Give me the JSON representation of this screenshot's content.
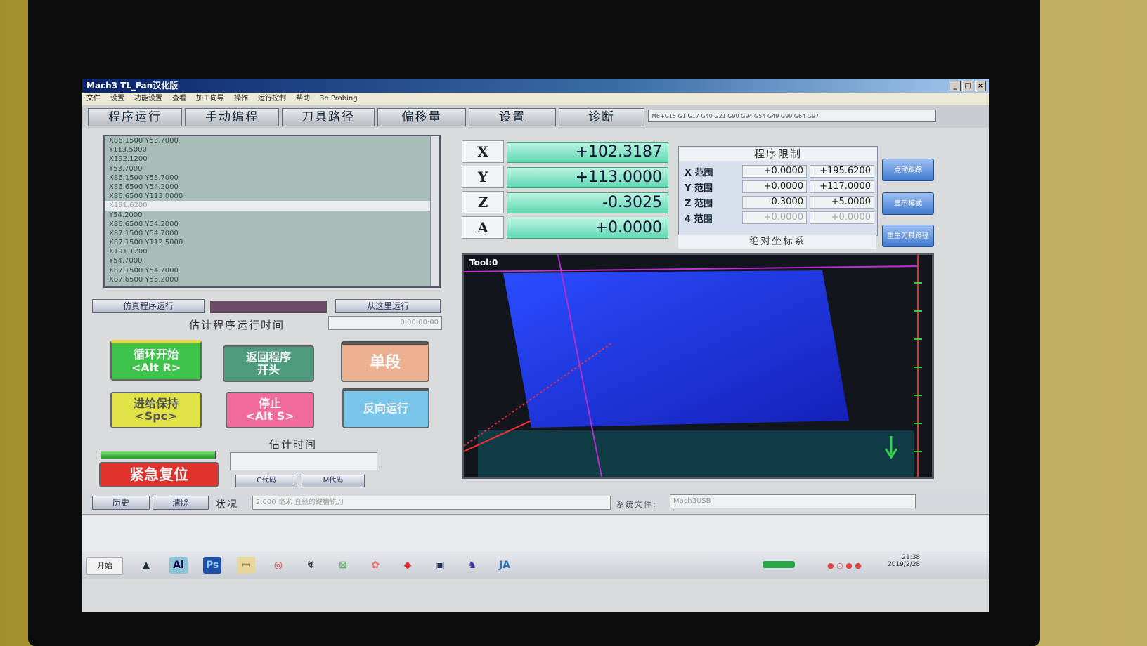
{
  "window": {
    "title": "Mach3 TL_Fan汉化版"
  },
  "menu": [
    "文件",
    "设置",
    "功能设置",
    "查看",
    "加工向导",
    "操作",
    "运行控制",
    "帮助",
    "3d Probing"
  ],
  "tabs": [
    "程序运行",
    "手动编程",
    "刀具路径",
    "偏移量",
    "设置",
    "诊断"
  ],
  "gcode_line": "M6+G15 G1 G17 G40 G21 G90 G94 G54 G49 G99 G64 G97",
  "code_lines": [
    "X86.1500 Y53.7000",
    "Y113.5000",
    "X192.1200",
    "Y53.7000",
    "X86.1500 Y53.7000",
    "X86.6500 Y54.2000",
    "X86.6500 Y113.0000",
    "X191.6200",
    "Y54.2000",
    "X86.6500 Y54.2000",
    "X87.1500 Y54.7000",
    "X87.1500 Y112.5000",
    "X191.1200",
    "Y54.7000",
    "X87.1500 Y54.7000",
    "X87.6500 Y55.2000"
  ],
  "program": {
    "simulate_label": "仿真程序运行",
    "run_from_here_label": "从这里运行",
    "estimate_label": "估计程序运行时间",
    "estimate_value": "0:00:00:00",
    "cycle_start": "循环开始\n<Alt R>",
    "rewind": "返回程序\n开头",
    "single_block": "单段",
    "feed_hold": "进给保持\n<Spc>",
    "stop": "停止\n<Alt S>",
    "reverse_run": "反向运行",
    "estimate_time_label": "估计时间",
    "emergency_reset": "紧急复位",
    "gcode_button": "G代码",
    "mcode_button": "M代码"
  },
  "dro": {
    "axes": [
      "X",
      "Y",
      "Z",
      "A"
    ],
    "values": [
      "+102.3187",
      "+113.0000",
      "-0.3025",
      "+0.0000"
    ]
  },
  "limits": {
    "title": "程序限制",
    "labels": [
      "X 范围",
      "Y 范围",
      "Z 范围",
      "4 范围"
    ],
    "min": [
      "+0.0000",
      "+0.0000",
      "-0.3000",
      "+0.0000"
    ],
    "max": [
      "+195.6200",
      "+117.0000",
      "+5.0000",
      "+0.0000"
    ],
    "footer": "绝对坐标系"
  },
  "side_buttons": [
    "点动跟踪",
    "显示模式",
    "重生刀具路径"
  ],
  "toolpath": {
    "label": "Tool:0"
  },
  "status": {
    "history_label": "历史",
    "clear_label": "清除",
    "status_label": "状况",
    "status_text": "2.000 毫米 直径的键槽铣刀",
    "profile_label": "系统文件:",
    "profile_value": "Mach3USB"
  },
  "taskbar": {
    "start_label": "开始",
    "time": "21:38",
    "date": "2019/2/28"
  },
  "colors": {
    "cycle_start": "#3fc44b",
    "rewind": "#4f9b7f",
    "single_block": "#eab090",
    "feed_hold": "#e1e246",
    "stop": "#f06a9a",
    "reverse_run": "#79c6ea",
    "emergency": "#e1312d"
  }
}
